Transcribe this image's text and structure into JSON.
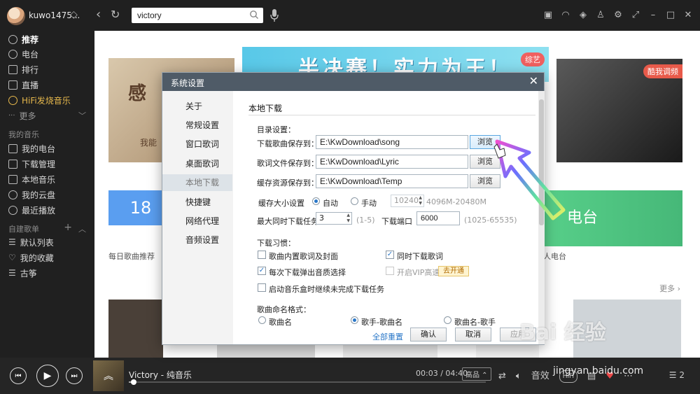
{
  "topbar": {
    "username": "kuwo1475...",
    "search_value": "victory",
    "icons": [
      "skin-icon",
      "headphones-icon",
      "gamepad-icon",
      "shirt-icon",
      "gear-icon",
      "mini-mode-icon",
      "minimize-icon",
      "maximize-icon",
      "close-icon"
    ]
  },
  "sidebar": {
    "items": [
      {
        "label": "推荐",
        "icon": "recommend-icon"
      },
      {
        "label": "电台",
        "icon": "radio-icon"
      },
      {
        "label": "排行",
        "icon": "chart-icon"
      },
      {
        "label": "直播",
        "icon": "live-icon"
      },
      {
        "label": "HiFi发烧音乐",
        "icon": "hifi-icon"
      },
      {
        "label": "更多",
        "icon": "more-icon"
      }
    ],
    "my_music_title": "我的音乐",
    "my_music": [
      {
        "label": "我的电台"
      },
      {
        "label": "下载管理"
      },
      {
        "label": "本地音乐"
      },
      {
        "label": "我的云盘"
      },
      {
        "label": "最近播放"
      }
    ],
    "playlists_title": "自建歌单",
    "playlists": [
      {
        "label": "默认列表"
      },
      {
        "label": "我的收藏"
      },
      {
        "label": "古筝"
      }
    ]
  },
  "main": {
    "banner_left_big": "感",
    "banner_left_small": "我能",
    "banner_center_text": "半决赛！实力为王！",
    "banner_center_tag": "综艺",
    "banner_right_tag": "酷我调频",
    "tile_left_number": "18",
    "tile_left_label": "每日歌曲推荐",
    "tile_right_text": "电台",
    "tile_right_label": "私人电台",
    "more_link": "更多 ›"
  },
  "player": {
    "song_title": "Victory - 纯音乐",
    "time": "00:03 / 04:40",
    "quality": "高品 ⌃",
    "progress": 0.0107,
    "queue_count": "2",
    "hifi": "HiFi",
    "sound_label": "音效"
  },
  "dialog": {
    "title": "系统设置",
    "nav": [
      "关于",
      "常规设置",
      "窗口歌词",
      "桌面歌词",
      "本地下载",
      "快捷键",
      "网络代理",
      "音频设置"
    ],
    "active_nav": 4,
    "section_title": "本地下载",
    "dir_label": "目录设置：",
    "dirs": [
      {
        "label": "下载歌曲保存到：",
        "value": "E:\\KwDownload\\song",
        "button": "浏览"
      },
      {
        "label": "歌词文件保存到：",
        "value": "E:\\KwDownload\\Lyric",
        "button": "浏览"
      },
      {
        "label": "缓存资源保存到：",
        "value": "E:\\KwDownload\\Temp",
        "button": "浏览"
      }
    ],
    "cache_label": "缓存大小设置",
    "cache_auto": "自动",
    "cache_manual": "手动",
    "cache_value": "10240",
    "cache_range": "4096M-20480M",
    "max_tasks_label": "最大同时下载任务",
    "max_tasks_value": "3",
    "max_tasks_range": "(1-5)",
    "port_label": "下载端口",
    "port_value": "6000",
    "port_range": "(1025-65535)",
    "habit_label": "下载习惯：",
    "habits": [
      {
        "label": "歌曲内置歌词及封面",
        "checked": false
      },
      {
        "label": "同时下载歌词",
        "checked": true
      },
      {
        "label": "每次下载弹出音质选择",
        "checked": true
      },
      {
        "label": "开启VIP高速",
        "checked": false
      },
      {
        "label": "启动音乐盒时继续未完成下载任务",
        "checked": false
      }
    ],
    "vip_button": "去开通",
    "naming_label": "歌曲命名格式：",
    "naming": [
      "歌曲名",
      "歌手-歌曲名",
      "歌曲名-歌手"
    ],
    "naming_selected": 1,
    "reset_link": "全部重置",
    "ok_button": "确认",
    "cancel_button": "取消",
    "apply_button": "应用"
  },
  "watermark": {
    "logo": "Bai 经验",
    "url": "jingyan.baidu.com"
  },
  "colors": {
    "dialog_title": "#4f5b67",
    "accent_blue": "#2a77c8",
    "hifi_gold": "#e6b84c"
  }
}
